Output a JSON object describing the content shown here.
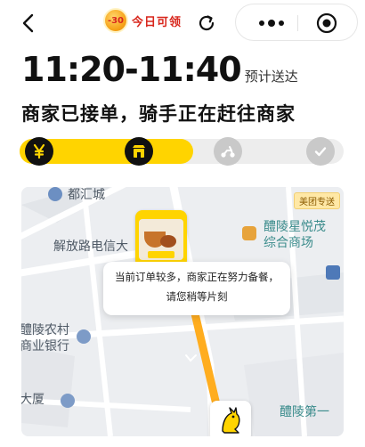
{
  "coupon": {
    "amount": "-30",
    "label": "今日可领"
  },
  "eta": {
    "time": "11:20-11:40",
    "label": "预计送达"
  },
  "status": "商家已接单，骑手正在赶往商家",
  "progress": {
    "steps": [
      "paid",
      "merchant",
      "rider",
      "delivered"
    ],
    "fraction_complete": 0.5
  },
  "map": {
    "brand_tag": "美团专送",
    "labels": {
      "duhuicheng": "都汇城",
      "jiefang_road": "解放路电信大",
      "xingyue_1": "醴陵星悦茂",
      "xingyue_2": "综合商场",
      "bank_1": "醴陵农村",
      "bank_2": "商业银行",
      "building": "大厦",
      "first": "醴陵第一"
    },
    "tooltip": "当前订单较多，商家正在努力备餐，请您稍等片刻"
  },
  "colors": {
    "brand_yellow": "#ffd400",
    "coupon_red": "#d8261c",
    "map_bg": "#e9ecef"
  }
}
